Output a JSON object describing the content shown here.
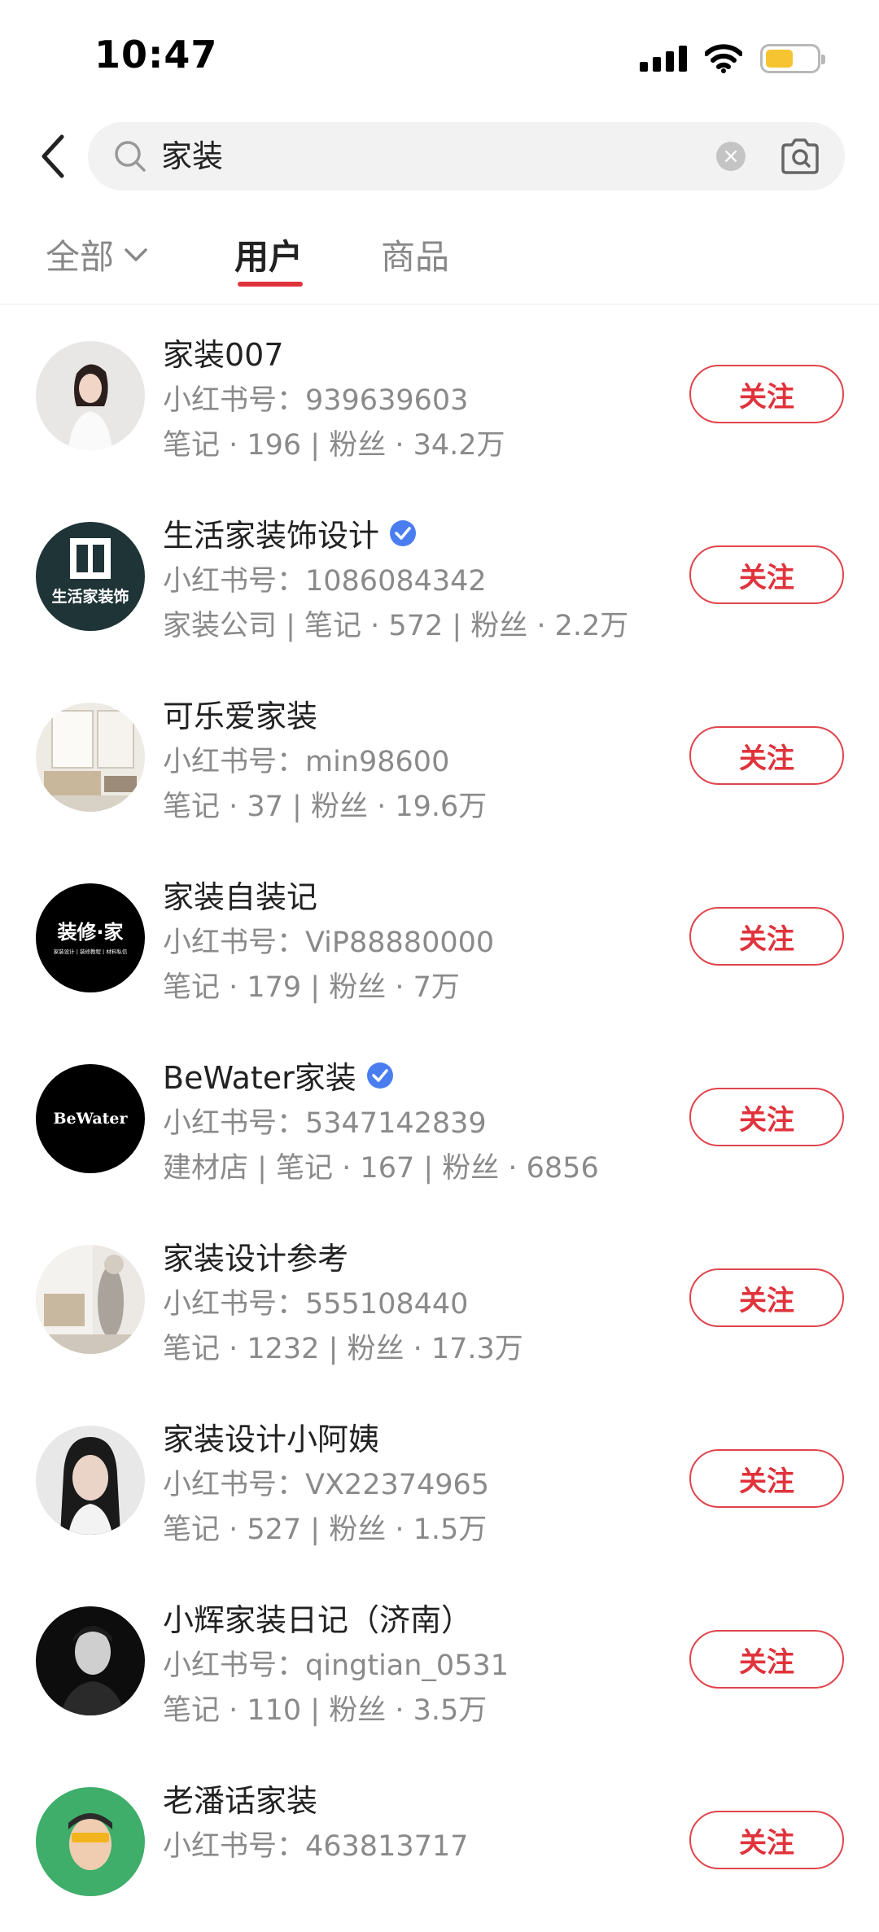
{
  "status_bar": {
    "time": "10:47",
    "icons": [
      "signal-icon",
      "wifi-icon",
      "battery-icon"
    ]
  },
  "search": {
    "query": "家装",
    "icons": [
      "back-icon",
      "search-icon",
      "clear-icon",
      "camera-icon"
    ]
  },
  "tabs": {
    "all_label": "全部",
    "users_label": "用户",
    "goods_label": "商品",
    "active": "用户"
  },
  "colors": {
    "accent": "#e0333c",
    "verified": "#4a7ef0",
    "battery": "#f5c430"
  },
  "users": [
    {
      "name": "家装007",
      "verified": false,
      "id_line": "小红书号：939639603",
      "stats": "笔记 · 196 | 粉丝 · 34.2万",
      "follow": "关注"
    },
    {
      "name": "生活家装饰设计",
      "verified": true,
      "id_line": "小红书号：1086084342",
      "stats": "家装公司 | 笔记 · 572 | 粉丝 · 2.2万",
      "follow": "关注",
      "avatar_text": "生活家装饰"
    },
    {
      "name": "可乐爱家装",
      "verified": false,
      "id_line": "小红书号：min98600",
      "stats": "笔记 · 37 | 粉丝 · 19.6万",
      "follow": "关注"
    },
    {
      "name": "家装自装记",
      "verified": false,
      "id_line": "小红书号：ViP88880000",
      "stats": "笔记 · 179 | 粉丝 · 7万",
      "follow": "关注",
      "avatar_text": "装修·家",
      "avatar_subtext": "家装设计 | 装修教程 | 材料私信"
    },
    {
      "name": "BeWater家装",
      "verified": true,
      "id_line": "小红书号：5347142839",
      "stats": "建材店 | 笔记 · 167 | 粉丝 · 6856",
      "follow": "关注",
      "avatar_text": "BeWater"
    },
    {
      "name": "家装设计参考",
      "verified": false,
      "id_line": "小红书号：555108440",
      "stats": "笔记 · 1232 | 粉丝 · 17.3万",
      "follow": "关注"
    },
    {
      "name": "家装设计小阿姨",
      "verified": false,
      "id_line": "小红书号：VX22374965",
      "stats": "笔记 · 527 | 粉丝 · 1.5万",
      "follow": "关注"
    },
    {
      "name": "小辉家装日记（济南）",
      "verified": false,
      "id_line": "小红书号：qingtian_0531",
      "stats": "笔记 · 110 | 粉丝 · 3.5万",
      "follow": "关注"
    },
    {
      "name": "老潘话家装",
      "verified": false,
      "id_line": "小红书号：463813717",
      "stats": "",
      "follow": "关注"
    }
  ]
}
